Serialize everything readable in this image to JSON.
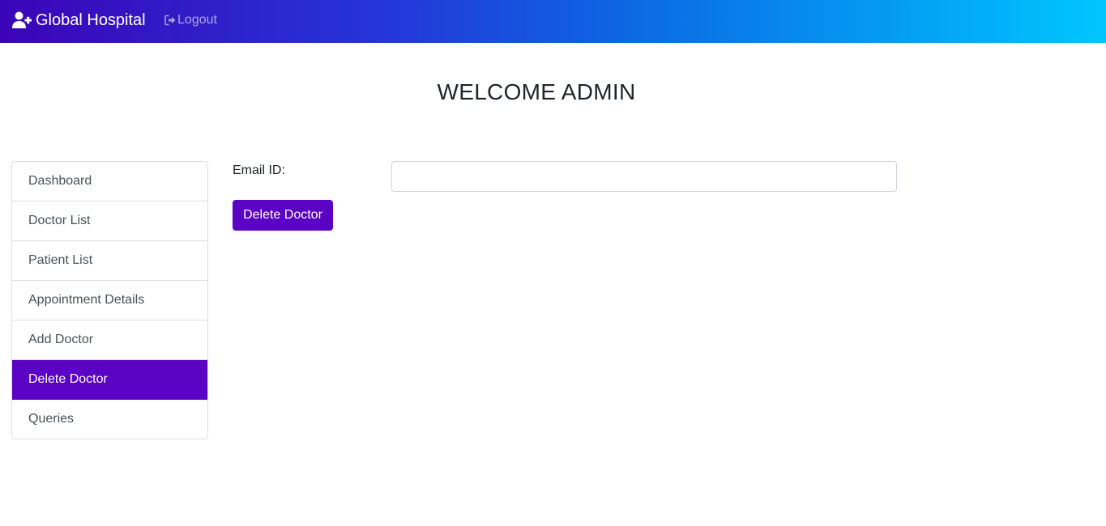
{
  "navbar": {
    "brand_icon": "user-plus-icon",
    "brand_text": "Global Hospital",
    "logout_icon": "sign-out-icon",
    "logout_label": "Logout",
    "gradient_colors": [
      "#3c04b8",
      "#0a6fe6",
      "#00c6ff"
    ]
  },
  "main": {
    "title": "WELCOME ADMIN"
  },
  "sidebar": {
    "items": [
      {
        "label": "Dashboard",
        "active": false
      },
      {
        "label": "Doctor List",
        "active": false
      },
      {
        "label": "Patient List",
        "active": false
      },
      {
        "label": "Appointment Details",
        "active": false
      },
      {
        "label": "Add Doctor",
        "active": false
      },
      {
        "label": "Delete Doctor",
        "active": true
      },
      {
        "label": "Queries",
        "active": false
      }
    ],
    "active_color": "#5b03c4"
  },
  "form": {
    "email_label": "Email ID:",
    "email_value": "",
    "submit_label": "Delete Doctor",
    "accent_color": "#5b03c4"
  }
}
